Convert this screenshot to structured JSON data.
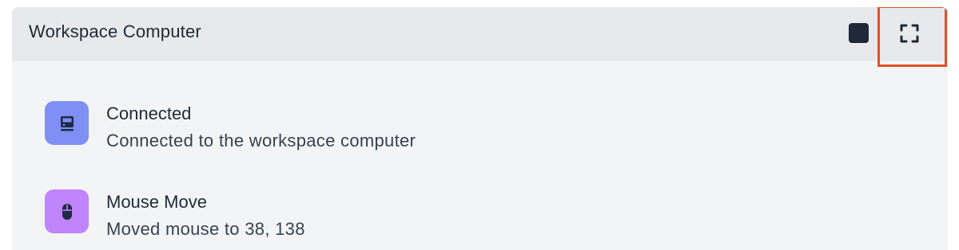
{
  "header": {
    "title": "Workspace Computer"
  },
  "controls": {
    "stop_icon": "stop-square-icon",
    "expand_icon": "fullscreen-expand-icon",
    "highlight_color": "#e0512a"
  },
  "events": [
    {
      "title": "Connected",
      "description": "Connected to the workspace computer",
      "icon": "computer-icon",
      "icon_bg": "#7f8ff4"
    },
    {
      "title": "Mouse Move",
      "description": "Moved mouse to 38, 138",
      "icon": "mouse-icon",
      "icon_bg": "#c084fc"
    }
  ]
}
